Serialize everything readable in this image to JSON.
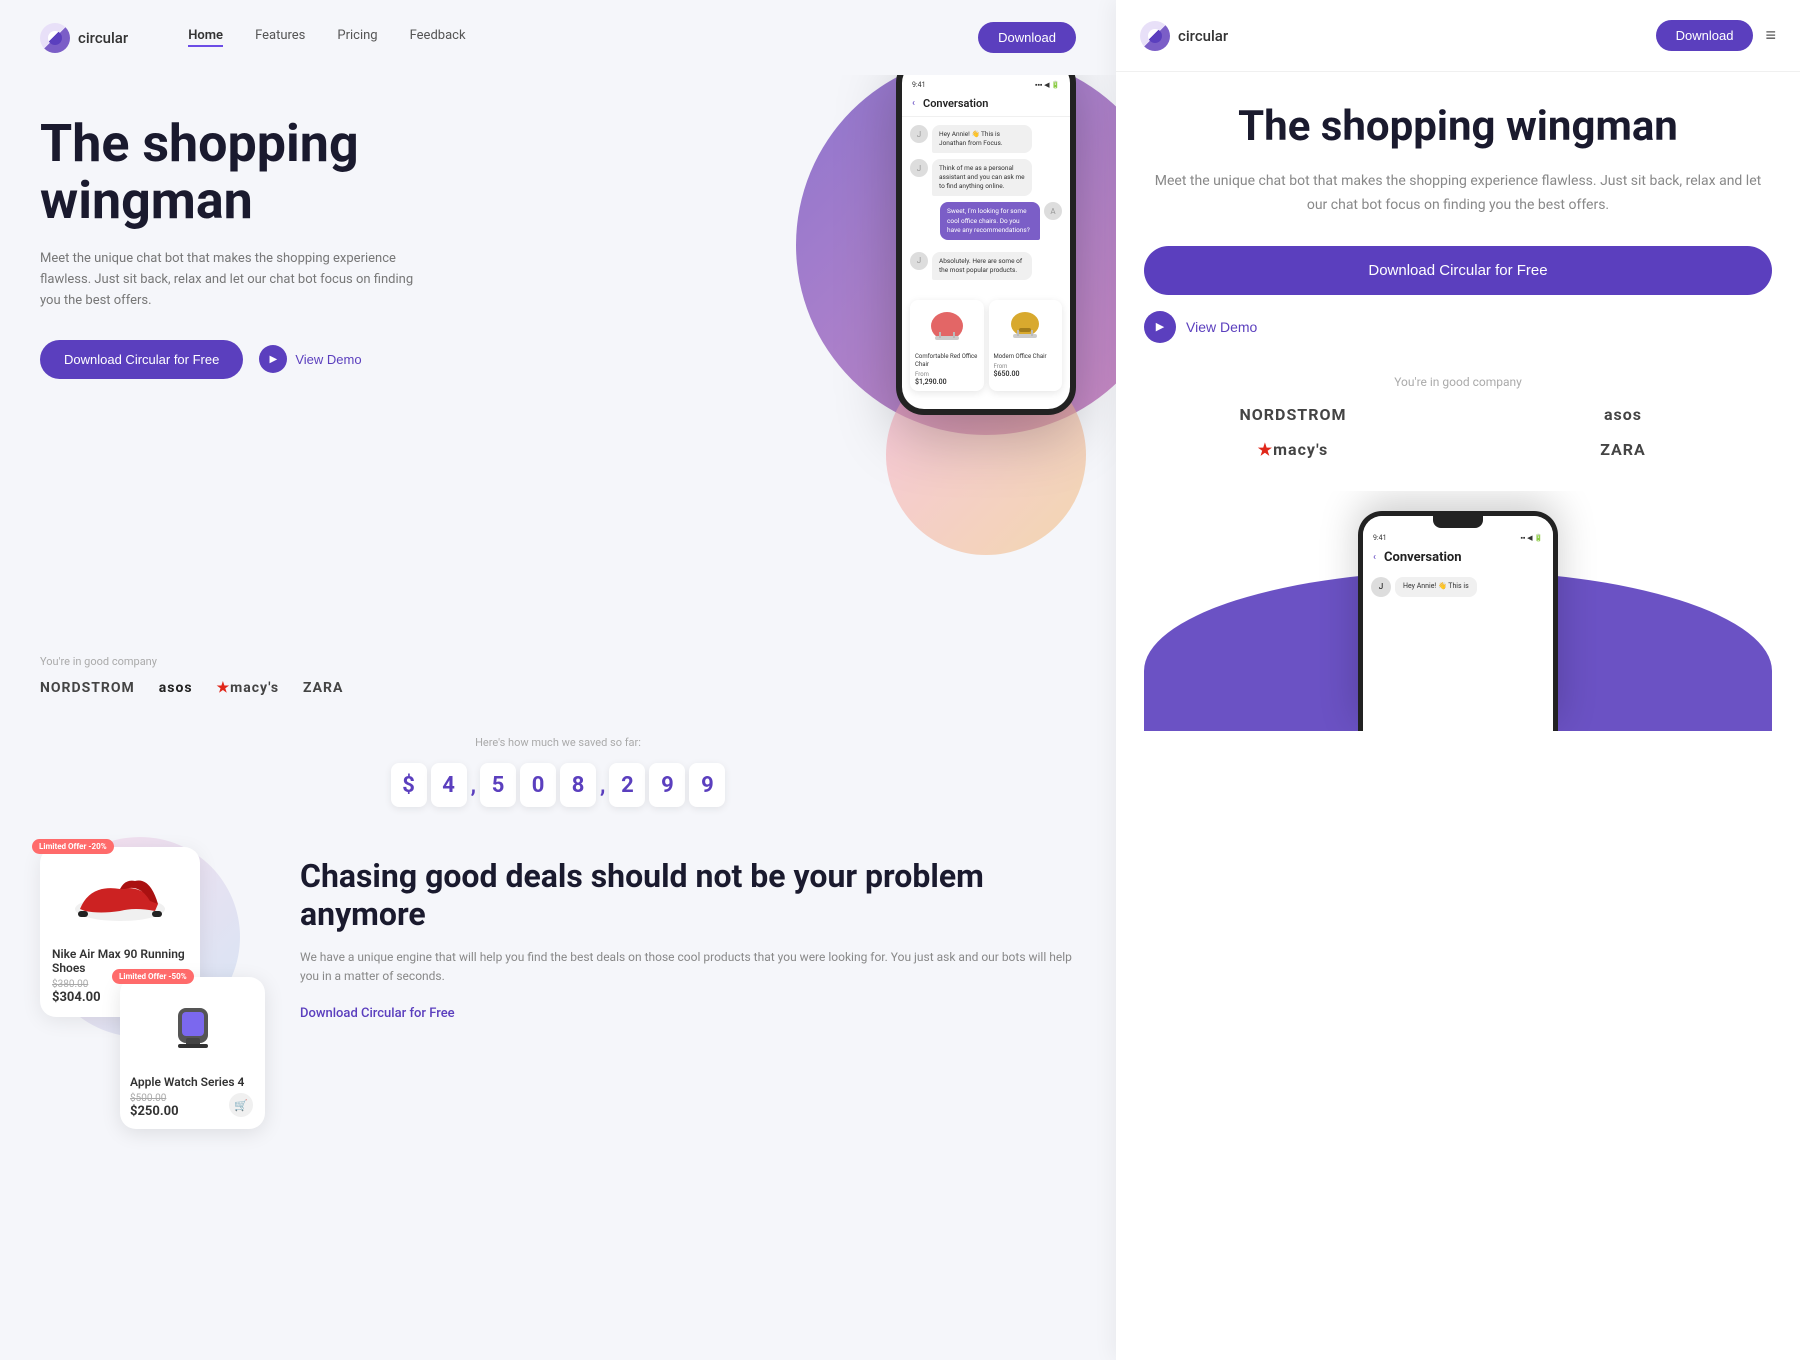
{
  "app": {
    "name": "circular",
    "tagline": "The shopping wingman",
    "description": "Meet the unique chat bot that makes the shopping experience flawless. Just sit back, relax and let our chat bot focus on finding you the best offers.",
    "download_label": "Download",
    "download_free_label": "Download Circular for Free",
    "view_demo_label": "View Demo"
  },
  "nav": {
    "links": [
      {
        "label": "Home",
        "active": true
      },
      {
        "label": "Features",
        "active": false
      },
      {
        "label": "Pricing",
        "active": false
      },
      {
        "label": "Feedback",
        "active": false
      }
    ]
  },
  "phone": {
    "time": "9:41",
    "conversation_title": "Conversation",
    "back_label": "‹",
    "chat": [
      {
        "side": "left",
        "text": "Hey Annie! 👋 This is Jonathan from Focus."
      },
      {
        "side": "left",
        "text": "Think of me as a personal assistant and you can ask me to find anything online."
      },
      {
        "side": "right",
        "text": "Sweet, I'm looking for some cool office chairs. Do you have any recommendations?"
      },
      {
        "side": "left",
        "text": "Absolutely. Here are some of the most popular products."
      }
    ],
    "products": [
      {
        "name": "Comfortable Red Office Chair",
        "from_label": "From",
        "price": "$1,290.00",
        "color": "red"
      },
      {
        "name": "Modern Office Chair",
        "from_label": "From",
        "price": "$650.00",
        "color": "yellow"
      }
    ]
  },
  "partners": {
    "label": "You're in good company",
    "logos": [
      "NORDSTROM",
      "asos",
      "★macy's",
      "ZARA"
    ]
  },
  "savings": {
    "label": "Here's how much we saved so far:",
    "digits": [
      "$",
      "4",
      ",",
      "5",
      "0",
      "8",
      ",",
      "2",
      "9",
      "9"
    ]
  },
  "deals": {
    "title": "Chasing good deals should not be your problem anymore",
    "description": "We have a unique engine that will help you find the best deals on those cool products that you were looking for. You just ask and our bots will help you in a matter of seconds.",
    "download_link": "Download Circular for Free",
    "products": [
      {
        "name": "Nike Air Max 90 Running Shoes",
        "old_price": "$380.00",
        "new_price": "$304.00",
        "badge": "Limited Offer -20%",
        "emoji": "👟"
      },
      {
        "name": "Apple Watch Series 4",
        "old_price": "$500.00",
        "new_price": "$250.00",
        "badge": "Limited Offer -50%",
        "emoji": "⌚"
      }
    ]
  },
  "right_panel": {
    "download_label": "Download",
    "menu_icon": "≡",
    "hero_title": "The shopping wingman",
    "hero_description": "Meet the unique chat bot that makes the shopping experience flawless. Just sit back, relax and let our chat bot focus on finding you the best offers.",
    "download_free_label": "Download Circular for Free",
    "view_demo_label": "View Demo",
    "partners_label": "You're in good company",
    "partner_logos": [
      "NORDSTROM",
      "asos",
      "★macy's",
      "ZARA"
    ],
    "phone": {
      "time": "9:41",
      "title": "Conversation",
      "back": "‹",
      "chat_preview": "Hey Annie! 👋 This is"
    }
  }
}
